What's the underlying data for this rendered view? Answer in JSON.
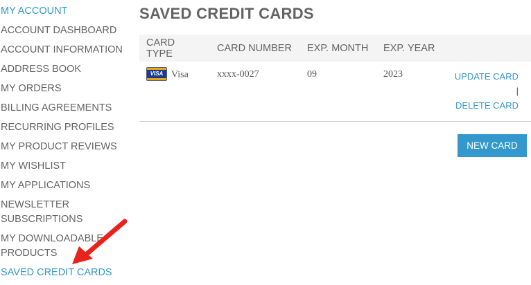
{
  "sidebar": {
    "title": "MY ACCOUNT",
    "items": [
      {
        "label": "ACCOUNT DASHBOARD"
      },
      {
        "label": "ACCOUNT INFORMATION"
      },
      {
        "label": "ADDRESS BOOK"
      },
      {
        "label": "MY ORDERS"
      },
      {
        "label": "BILLING AGREEMENTS"
      },
      {
        "label": "RECURRING PROFILES"
      },
      {
        "label": "MY PRODUCT REVIEWS"
      },
      {
        "label": "MY WISHLIST"
      },
      {
        "label": "MY APPLICATIONS"
      },
      {
        "label": "NEWSLETTER SUBSCRIPTIONS"
      },
      {
        "label": "MY DOWNLOADABLE PRODUCTS"
      },
      {
        "label": "SAVED CREDIT CARDS"
      }
    ]
  },
  "main": {
    "title": "SAVED CREDIT CARDS",
    "table": {
      "headers": [
        "CARD TYPE",
        "CARD NUMBER",
        "EXP. MONTH",
        "EXP. YEAR"
      ],
      "rows": [
        {
          "card_icon_text": "VISA",
          "card_type": "Visa",
          "card_number": "xxxx-0027",
          "exp_month": "09",
          "exp_year": "2023",
          "update_label": "UPDATE CARD",
          "separator": "|",
          "delete_label": "DELETE CARD"
        }
      ]
    },
    "new_card_label": "NEW CARD"
  },
  "colors": {
    "accent": "#3399cc",
    "text": "#636363",
    "header_bg": "#f4f4f4",
    "annotation_arrow": "#e8231c"
  },
  "icons": [
    "visa-card-icon",
    "red-arrow-icon"
  ]
}
